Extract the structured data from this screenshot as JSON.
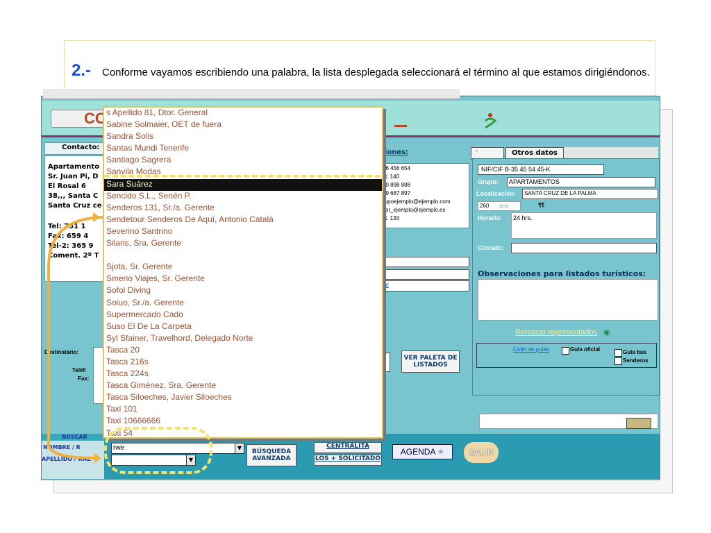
{
  "caption": {
    "number": "2.-",
    "text": "Conforme vayamos escribiendo una palabra, la lista desplegada seleccionará el término al que estamos dirigiéndonos."
  },
  "header": {
    "logo": "CO",
    "tab_active": "·",
    "tab_other": "Otros datos"
  },
  "left": {
    "contact_label": "Contacto:",
    "lines": [
      "Apartamento",
      "Sr. Juan Pi, D",
      "El Rosal 6",
      "38,,, Santa C",
      "Santa Cruz ce",
      "Tel:   751 1",
      "Fax:   659 4",
      "Tel-2:  365 9",
      "Coment. 2º T"
    ],
    "dest_label": "Destinatario:",
    "tel_label": "Teléf:",
    "fax_label": "Fax:"
  },
  "middle": {
    "title": "ciones:",
    "lines": [
      "56 456 654",
      "xt. 140",
      "20 898 888",
      "89 687 897",
      "rupoejemplo@ejemplo.com",
      "ltor_ejemplo@ejemplo.es",
      "xt. 133"
    ],
    "link": "m/",
    "ver_paleta": "VER PALETA DE LISTADOS"
  },
  "right": {
    "nif": "NIF/CIF  B-35 45 54 45-K",
    "grupo_label": "Grupo:",
    "grupo_value": "APARTAMENTOS",
    "loc_label": "Localización:",
    "loc_value": "SANTA CRUZ DE LA PALMA",
    "pax_num": "260",
    "pax_label": "pax",
    "pax_sym": "¶¶",
    "horario_label": "Horario:",
    "horario_value": "24 hrs.",
    "cerrado_label": "Cerrado:",
    "obs_label": "Observaciones para listados turísticos:",
    "rentacar": "Rentacar representados",
    "listin": "Listín de guías",
    "guia_oficial": "Guía oficial",
    "guia_bus": "Guía bus",
    "senderos": "Senderos"
  },
  "dropdown": {
    "items": [
      "s Apellido  81, Dtor. General",
      "Sabine Solmaier, OET de fuera",
      "Sandra Solis",
      "Santas Mundi Tenerife",
      "Santiago Sagrera",
      "Sanvila Modas",
      "Sara Suárez",
      "Sencido S.L., Senén P.",
      "Senderos 131, Sr./a. Gerente",
      "Sendetour Senderos De Aquí, Antonio Catalá",
      "Severino Santrino",
      "Silaris, Sra. Gerente",
      "",
      "Sjota, Sr. Gerente",
      "Smerio Viajes, Sr. Gerente",
      "Sofol Diving",
      "Soiuo, Sr./a. Gerente",
      "Supermercado Cado",
      "Suso El De La Carpeta",
      "Syl Sfainer, Travelhord, Delegado Norte",
      "Tasca 20",
      "Tasca 216s",
      "Tasca 224s",
      "Tasca Giménez, Sra. Gerente",
      "Tasca Siloeches, Javier Siloeches",
      "Taxi  101",
      "Taxi  10666666",
      "Taxi 54"
    ],
    "selected_index": 6
  },
  "bottom": {
    "buscar": "BUSCAR",
    "nombre": "NOMBRE / R",
    "apellido": "APELLIDO / RAZ",
    "input_value": "rwe",
    "busqueda": "BÚSQUEDA AVANZADA",
    "centralita": "CENTRALITA",
    "solicitado": "LOS + SOLICITADO",
    "agenda": "AGENDA",
    "salir": "SALIR"
  }
}
